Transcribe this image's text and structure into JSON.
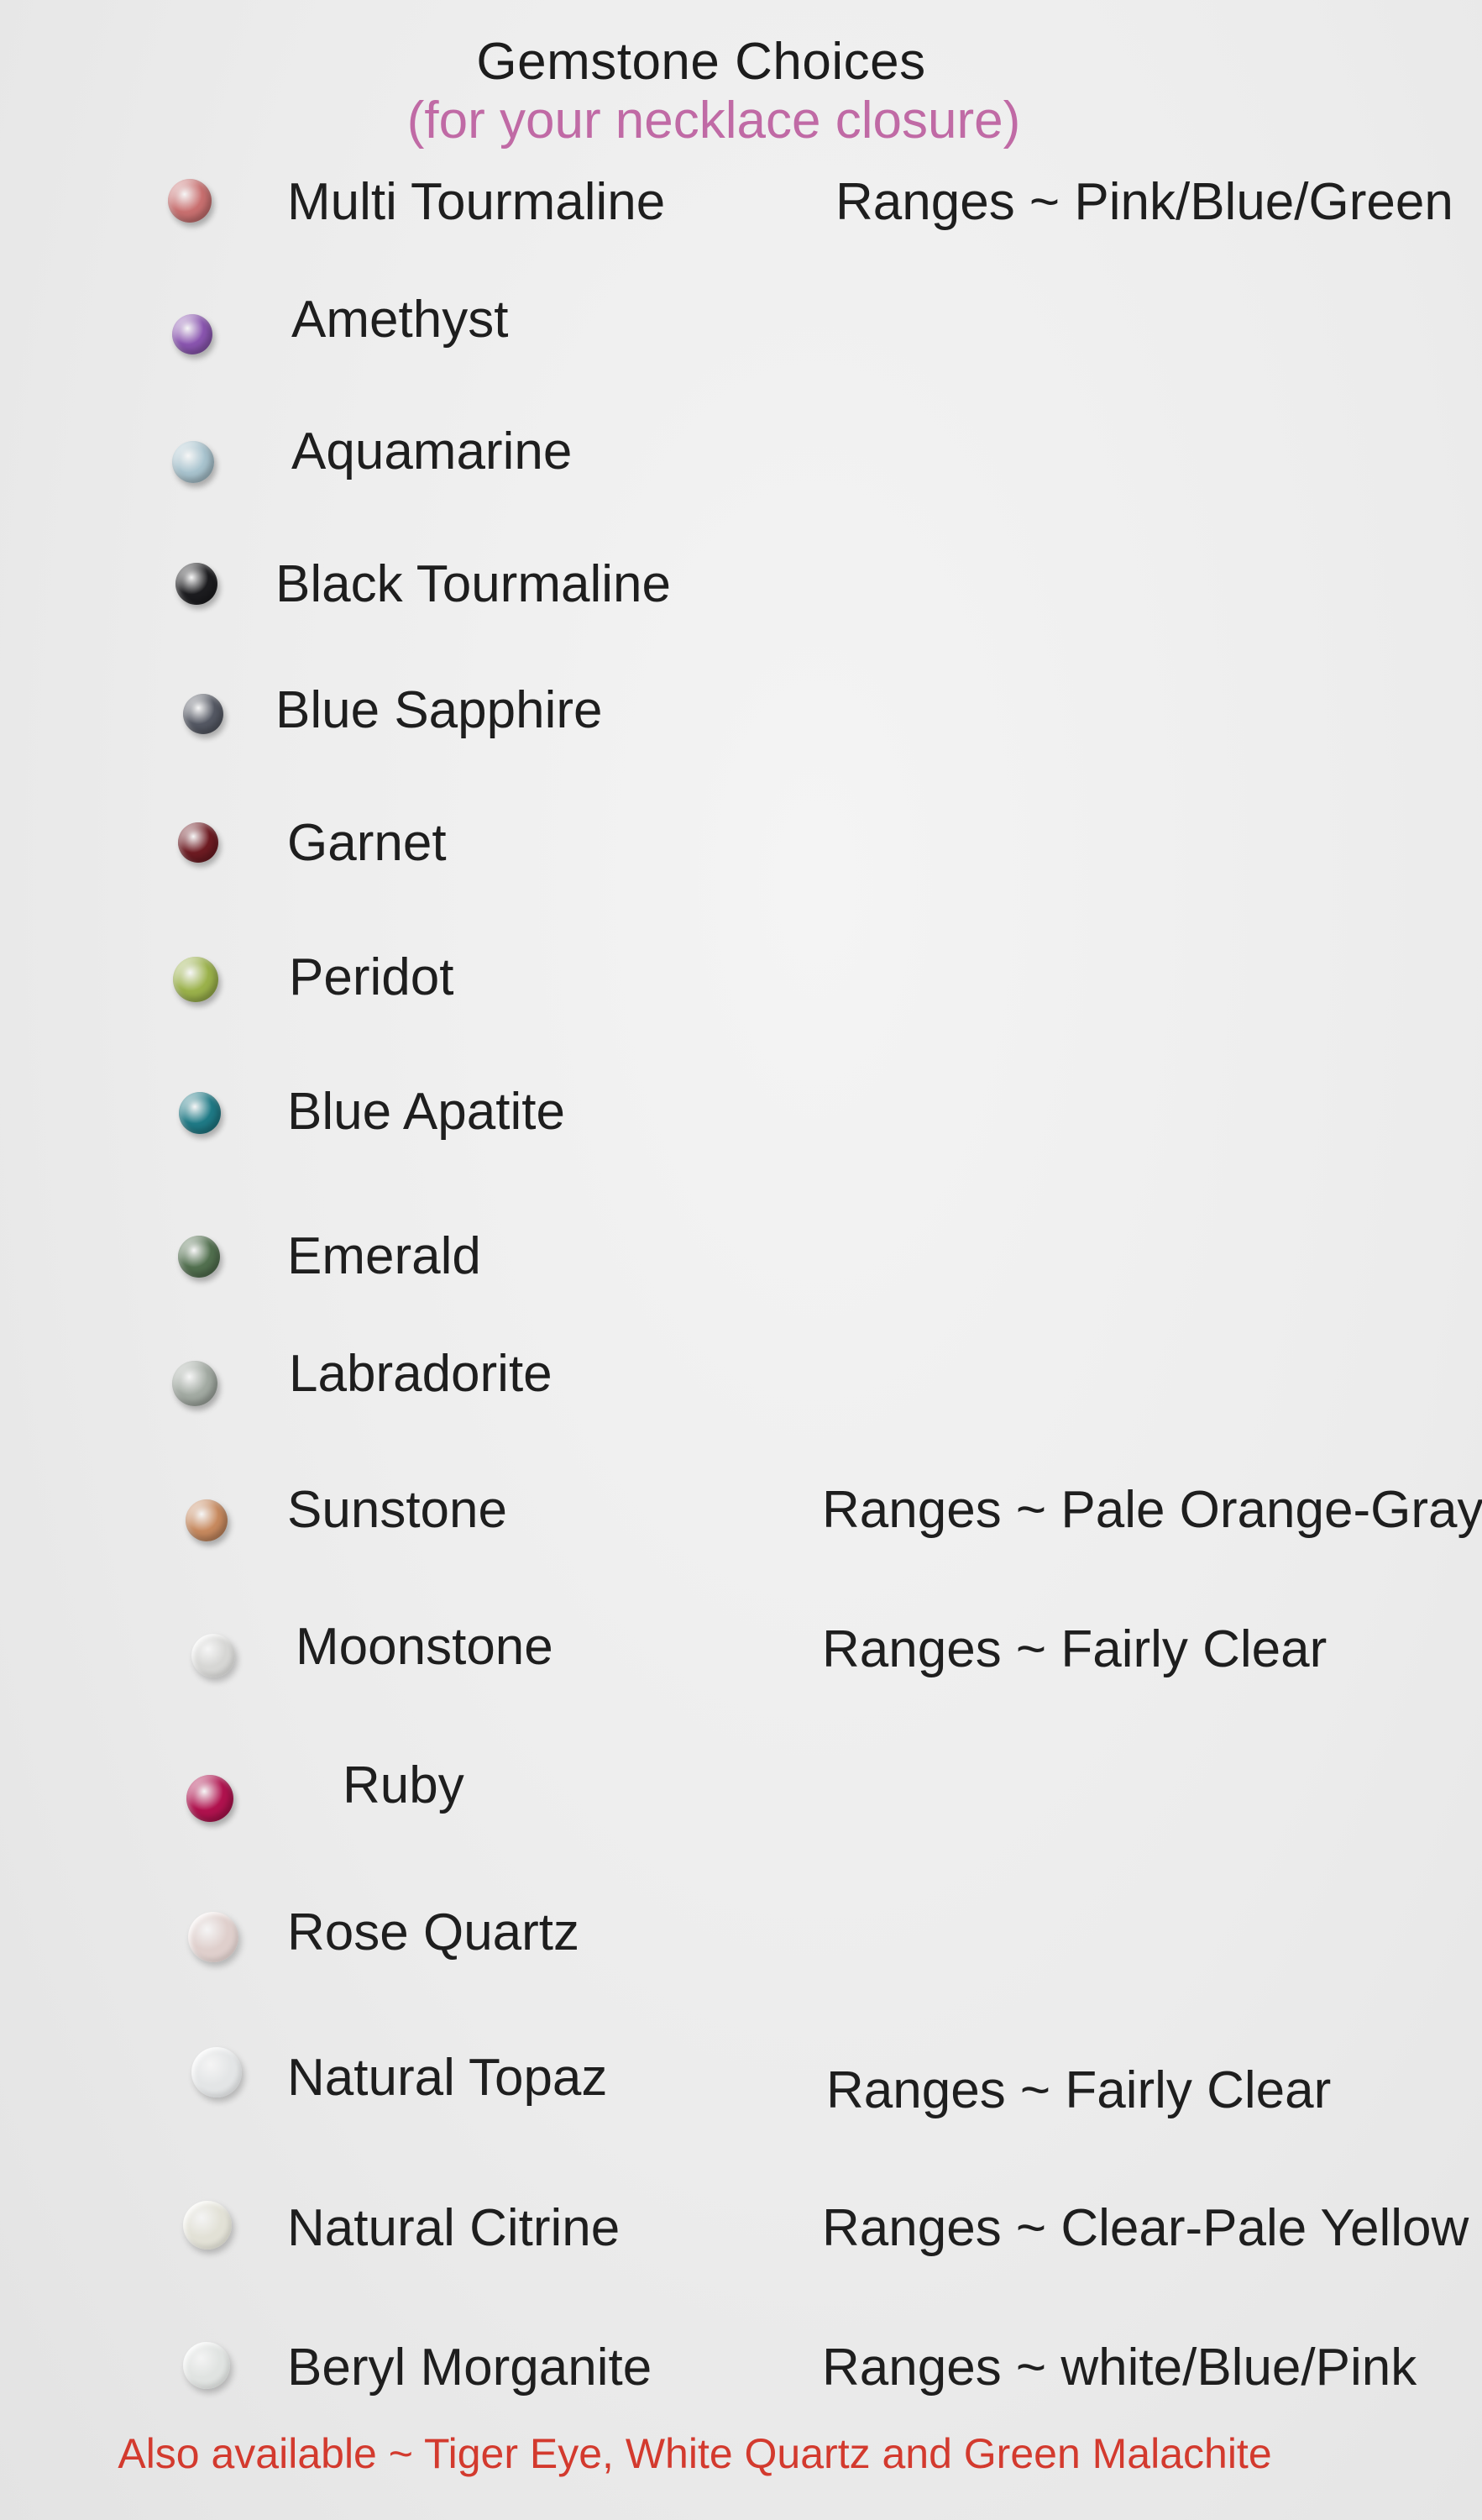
{
  "header": {
    "title": "Gemstone Choices",
    "subtitle": "(for your necklace closure)"
  },
  "gemstones": [
    {
      "name": "Multi Tourmaline",
      "range": "Ranges ~ Pink/Blue/Green",
      "color": "#c97070",
      "icon": "multi-tourmaline-stone-icon"
    },
    {
      "name": "Amethyst",
      "range": "",
      "color": "#8a55b0",
      "icon": "amethyst-stone-icon"
    },
    {
      "name": "Aquamarine",
      "range": "",
      "color": "#a9c4cf",
      "icon": "aquamarine-stone-icon"
    },
    {
      "name": "Black Tourmaline",
      "range": "",
      "color": "#1c1c1f",
      "icon": "black-tourmaline-stone-icon"
    },
    {
      "name": "Blue Sapphire",
      "range": "",
      "color": "#545863",
      "icon": "blue-sapphire-stone-icon"
    },
    {
      "name": "Garnet",
      "range": "",
      "color": "#6e1b22",
      "icon": "garnet-stone-icon"
    },
    {
      "name": "Peridot",
      "range": "",
      "color": "#9bb24b",
      "icon": "peridot-stone-icon"
    },
    {
      "name": "Blue Apatite",
      "range": "",
      "color": "#1f7a86",
      "icon": "blue-apatite-stone-icon"
    },
    {
      "name": "Emerald",
      "range": "",
      "color": "#52704f",
      "icon": "emerald-stone-icon"
    },
    {
      "name": "Labradorite",
      "range": "",
      "color": "#a3aba3",
      "icon": "labradorite-stone-icon"
    },
    {
      "name": "Sunstone",
      "range": "Ranges ~ Pale Orange-Gray",
      "color": "#c88a5f",
      "icon": "sunstone-stone-icon"
    },
    {
      "name": "Moonstone",
      "range": "Ranges ~ Fairly Clear",
      "color": "#d6d6d4",
      "icon": "moonstone-stone-icon"
    },
    {
      "name": "Ruby",
      "range": "",
      "color": "#b0124e",
      "icon": "ruby-stone-icon"
    },
    {
      "name": "Rose Quartz",
      "range": "",
      "color": "#dfcfcc",
      "icon": "rose-quartz-stone-icon"
    },
    {
      "name": "Natural Topaz",
      "range": "Ranges ~ Fairly Clear",
      "color": "#e3e5e6",
      "icon": "natural-topaz-stone-icon"
    },
    {
      "name": "Natural Citrine",
      "range": "Ranges ~ Clear-Pale Yellow",
      "color": "#e2e1d6",
      "icon": "natural-citrine-stone-icon"
    },
    {
      "name": "Beryl Morganite",
      "range": "Ranges ~ white/Blue/Pink",
      "color": "#e0e3e1",
      "icon": "beryl-morganite-stone-icon"
    }
  ],
  "footer": {
    "note": "Also available ~ Tiger Eye, White Quartz and Green Malachite"
  }
}
